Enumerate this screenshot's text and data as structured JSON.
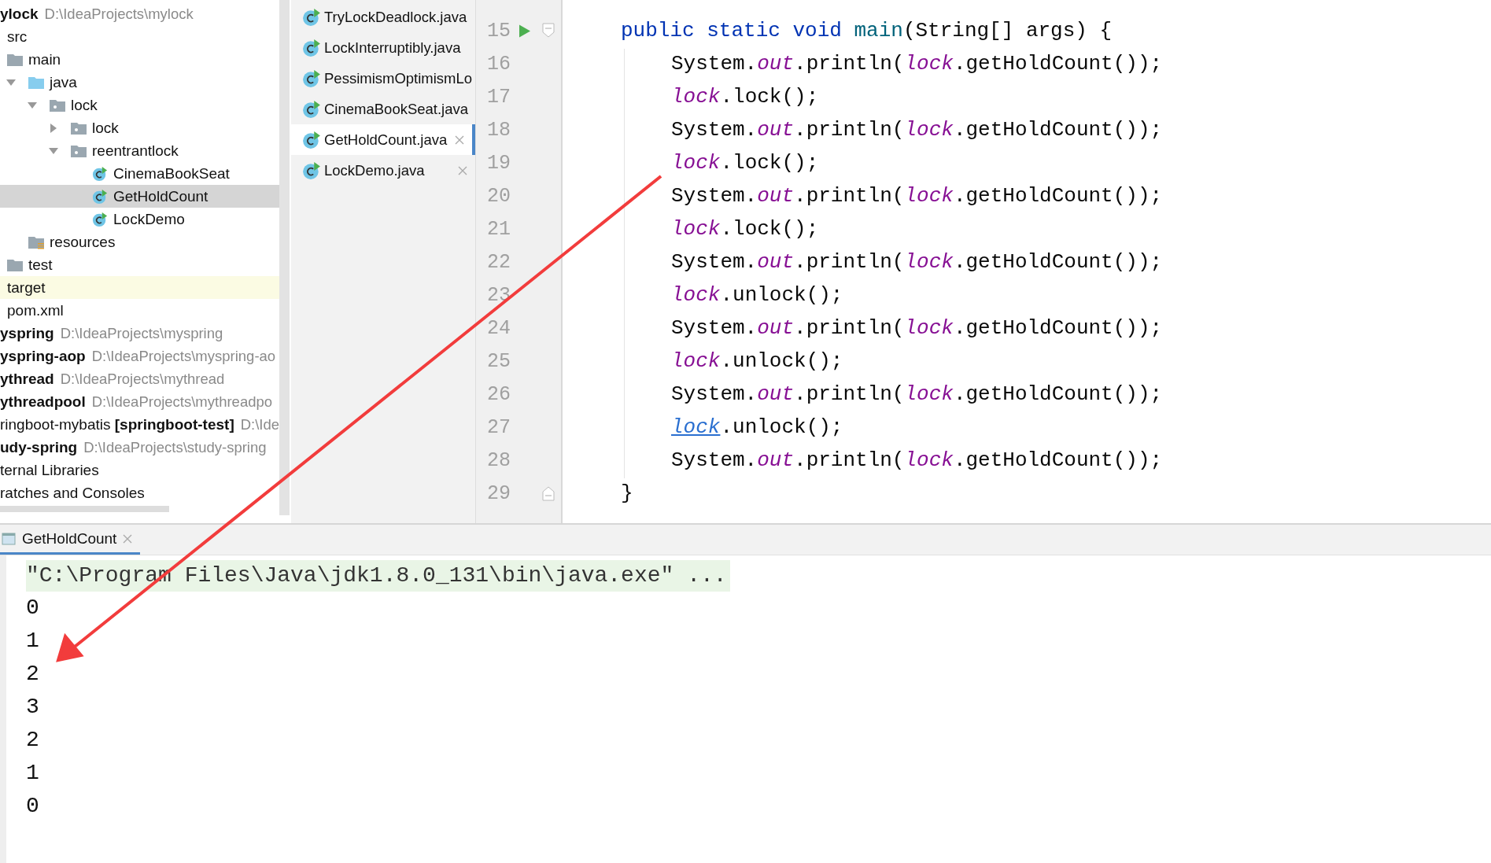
{
  "project_tree": [
    {
      "name": "ylock",
      "path": "D:\\IdeaProjects\\mylock",
      "kind": "module",
      "bold": true,
      "selected": false,
      "children": [
        {
          "name": "src",
          "kind": "folder",
          "selected": false,
          "children": [
            {
              "name": "main",
              "kind": "folder",
              "selected": false,
              "children": [
                {
                  "name": "java",
                  "kind": "source-folder",
                  "expanded": true,
                  "selected": false,
                  "children": [
                    {
                      "name": "lock",
                      "kind": "package",
                      "expanded": true,
                      "selected": false,
                      "children": [
                        {
                          "name": "lock",
                          "kind": "package",
                          "expanded": false,
                          "selected": false
                        },
                        {
                          "name": "reentrantlock",
                          "kind": "package",
                          "expanded": true,
                          "selected": false,
                          "children": [
                            {
                              "name": "CinemaBookSeat",
                              "kind": "class",
                              "selected": false
                            },
                            {
                              "name": "GetHoldCount",
                              "kind": "class",
                              "selected": true
                            },
                            {
                              "name": "LockDemo",
                              "kind": "class",
                              "selected": false
                            }
                          ]
                        }
                      ]
                    }
                  ]
                },
                {
                  "name": "resources",
                  "kind": "resources-folder",
                  "selected": false
                }
              ]
            },
            {
              "name": "test",
              "kind": "folder",
              "selected": false
            }
          ]
        },
        {
          "name": "target",
          "kind": "excluded-folder",
          "selected": false
        },
        {
          "name": "pom.xml",
          "kind": "file",
          "selected": false
        }
      ]
    },
    {
      "name": "yspring",
      "path": "D:\\IdeaProjects\\myspring",
      "kind": "module",
      "bold": true,
      "selected": false
    },
    {
      "name": "yspring-aop",
      "path": "D:\\IdeaProjects\\myspring-ao",
      "kind": "module",
      "bold": true,
      "selected": false
    },
    {
      "name": "ythread",
      "path": "D:\\IdeaProjects\\mythread",
      "kind": "module",
      "bold": true,
      "selected": false
    },
    {
      "name": "ythreadpool",
      "path": "D:\\IdeaProjects\\mythreadpo",
      "kind": "module",
      "bold": true,
      "selected": false
    },
    {
      "name": "ringboot-mybatis **[springboot-test]**",
      "path": "D:\\Ide",
      "kind": "module",
      "bold": false,
      "selected": false
    },
    {
      "name": "udy-spring",
      "path": "D:\\IdeaProjects\\study-spring",
      "kind": "module",
      "bold": true,
      "selected": false
    },
    {
      "name": "ternal Libraries",
      "kind": "library",
      "selected": false
    },
    {
      "name": "ratches and Consoles",
      "kind": "scratches",
      "selected": false
    }
  ],
  "open_files": [
    {
      "name": "TryLockDeadlock.java",
      "selected": false,
      "closable": false
    },
    {
      "name": "LockInterruptibly.java",
      "selected": false,
      "closable": false
    },
    {
      "name": "PessimismOptimismLo",
      "selected": false,
      "closable": false
    },
    {
      "name": "CinemaBookSeat.java",
      "selected": false,
      "closable": false
    },
    {
      "name": "GetHoldCount.java",
      "selected": true,
      "closable": true
    },
    {
      "name": "LockDemo.java",
      "selected": false,
      "closable": true
    }
  ],
  "editor": {
    "lines": [
      {
        "number": "15",
        "kind": "method-start",
        "run": true,
        "fold": true,
        "tokens": [
          {
            "text": "public static void",
            "kind": "keyword"
          },
          {
            "text": "main",
            "kind": "method"
          },
          {
            "text": "(String[] args) {",
            "kind": "plain"
          }
        ]
      },
      {
        "number": "16",
        "kind": "body",
        "run": false,
        "tokens": [
          {
            "text": "System.",
            "kind": "plain"
          },
          {
            "text": "out",
            "kind": "field"
          },
          {
            "text": ".println(",
            "kind": "plain"
          },
          {
            "text": "lock",
            "kind": "field"
          },
          {
            "text": ".getHoldCount());",
            "kind": "plain"
          }
        ]
      },
      {
        "number": "17",
        "kind": "body",
        "run": false,
        "tokens": [
          {
            "text": "lock",
            "kind": "field"
          },
          {
            "text": ".lock();",
            "kind": "plain"
          }
        ]
      },
      {
        "number": "18",
        "kind": "body",
        "run": false,
        "tokens": [
          {
            "text": "System.",
            "kind": "plain"
          },
          {
            "text": "out",
            "kind": "field"
          },
          {
            "text": ".println(",
            "kind": "plain"
          },
          {
            "text": "lock",
            "kind": "field"
          },
          {
            "text": ".getHoldCount());",
            "kind": "plain"
          }
        ]
      },
      {
        "number": "19",
        "kind": "body",
        "run": false,
        "tokens": [
          {
            "text": "lock",
            "kind": "field"
          },
          {
            "text": ".lock();",
            "kind": "plain"
          }
        ]
      },
      {
        "number": "20",
        "kind": "body",
        "run": false,
        "tokens": [
          {
            "text": "System.",
            "kind": "plain"
          },
          {
            "text": "out",
            "kind": "field"
          },
          {
            "text": ".println(",
            "kind": "plain"
          },
          {
            "text": "lock",
            "kind": "field"
          },
          {
            "text": ".getHoldCount());",
            "kind": "plain"
          }
        ]
      },
      {
        "number": "21",
        "kind": "body",
        "run": false,
        "tokens": [
          {
            "text": "lock",
            "kind": "field"
          },
          {
            "text": ".lock();",
            "kind": "plain"
          }
        ]
      },
      {
        "number": "22",
        "kind": "body",
        "run": false,
        "tokens": [
          {
            "text": "System.",
            "kind": "plain"
          },
          {
            "text": "out",
            "kind": "field"
          },
          {
            "text": ".println(",
            "kind": "plain"
          },
          {
            "text": "lock",
            "kind": "field"
          },
          {
            "text": ".getHoldCount());",
            "kind": "plain"
          }
        ]
      },
      {
        "number": "23",
        "kind": "body",
        "run": false,
        "tokens": [
          {
            "text": "lock",
            "kind": "field"
          },
          {
            "text": ".unlock();",
            "kind": "plain"
          }
        ]
      },
      {
        "number": "24",
        "kind": "body",
        "run": false,
        "tokens": [
          {
            "text": "System.",
            "kind": "plain"
          },
          {
            "text": "out",
            "kind": "field"
          },
          {
            "text": ".println(",
            "kind": "plain"
          },
          {
            "text": "lock",
            "kind": "field"
          },
          {
            "text": ".getHoldCount());",
            "kind": "plain"
          }
        ]
      },
      {
        "number": "25",
        "kind": "body",
        "run": false,
        "tokens": [
          {
            "text": "lock",
            "kind": "field"
          },
          {
            "text": ".unlock();",
            "kind": "plain"
          }
        ]
      },
      {
        "number": "26",
        "kind": "body",
        "run": false,
        "tokens": [
          {
            "text": "System.",
            "kind": "plain"
          },
          {
            "text": "out",
            "kind": "field"
          },
          {
            "text": ".println(",
            "kind": "plain"
          },
          {
            "text": "lock",
            "kind": "field"
          },
          {
            "text": ".getHoldCount());",
            "kind": "plain"
          }
        ]
      },
      {
        "number": "27",
        "kind": "body",
        "run": false,
        "tokens": [
          {
            "text": "lock",
            "kind": "link"
          },
          {
            "text": ".unlock();",
            "kind": "plain"
          }
        ]
      },
      {
        "number": "28",
        "kind": "body",
        "run": false,
        "tokens": [
          {
            "text": "System.",
            "kind": "plain"
          },
          {
            "text": "out",
            "kind": "field"
          },
          {
            "text": ".println(",
            "kind": "plain"
          },
          {
            "text": "lock",
            "kind": "field"
          },
          {
            "text": ".getHoldCount());",
            "kind": "plain"
          }
        ]
      },
      {
        "number": "29",
        "kind": "method-end",
        "run": false,
        "fold": true,
        "tokens": [
          {
            "text": "}",
            "kind": "plain"
          }
        ]
      }
    ]
  },
  "run_panel": {
    "tab": {
      "label": "GetHoldCount",
      "selected": true
    },
    "command": "\"C:\\Program Files\\Java\\jdk1.8.0_131\\bin\\java.exe\" ...",
    "output": [
      "0",
      "1",
      "2",
      "3",
      "2",
      "1",
      "0"
    ]
  }
}
